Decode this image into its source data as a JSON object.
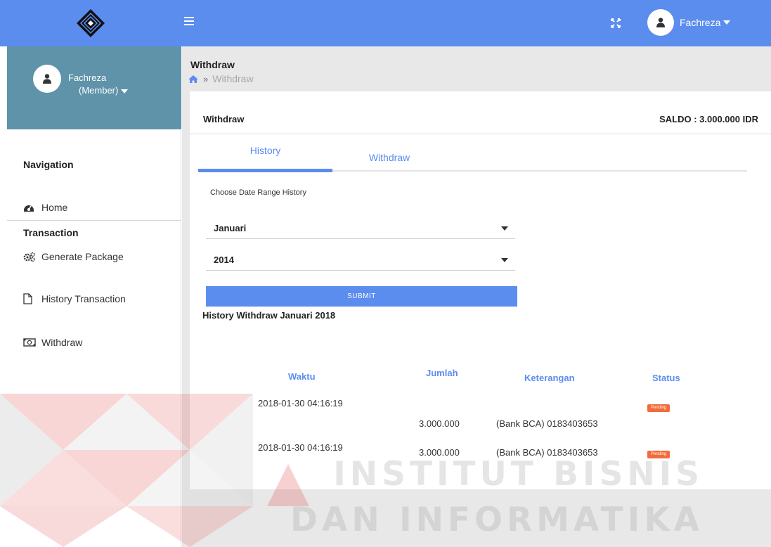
{
  "header": {
    "user_name": "Fachreza"
  },
  "sidebar": {
    "profile_name": "Fachreza",
    "profile_role": "(Member)",
    "nav_heading": "Navigation",
    "home_label": "Home",
    "section_transaction": "Transaction",
    "items": [
      {
        "label": "Generate Package",
        "icon": "gears-icon"
      },
      {
        "label": "History Transaction",
        "icon": "file-icon"
      },
      {
        "label": "Withdraw",
        "icon": "money-icon"
      }
    ]
  },
  "page": {
    "title": "Withdraw",
    "breadcrumb_current": "Withdraw"
  },
  "card": {
    "title": "Withdraw",
    "saldo": "SALDO : 3.000.000 IDR",
    "tabs": [
      "History",
      "Withdraw"
    ],
    "range_label": "Choose Date Range History",
    "month_value": "Januari",
    "year_value": "2014",
    "submit_label": "SUBMIT",
    "history_title": "History Withdraw Januari 2018"
  },
  "table": {
    "columns": [
      "Waktu",
      "Jumlah",
      "Keterangan",
      "Status"
    ],
    "rows": [
      {
        "waktu": "2018-01-30 04:16:19",
        "jumlah": "3.000.000",
        "keterangan": "(Bank BCA) 0183403653",
        "status": "Pending"
      },
      {
        "waktu": "2018-01-30 04:16:19",
        "jumlah": "3.000.000",
        "keterangan": "(Bank BCA) 0183403653",
        "status": "Pending"
      }
    ]
  },
  "watermark": {
    "line1": "INSTITUT BISNIS",
    "line2": "DAN INFORMATIKA"
  },
  "colors": {
    "topbar": "#5b8def",
    "profile_panel": "#5f93a9",
    "accent": "#5b8def",
    "status_pending": "#f26b3a"
  }
}
